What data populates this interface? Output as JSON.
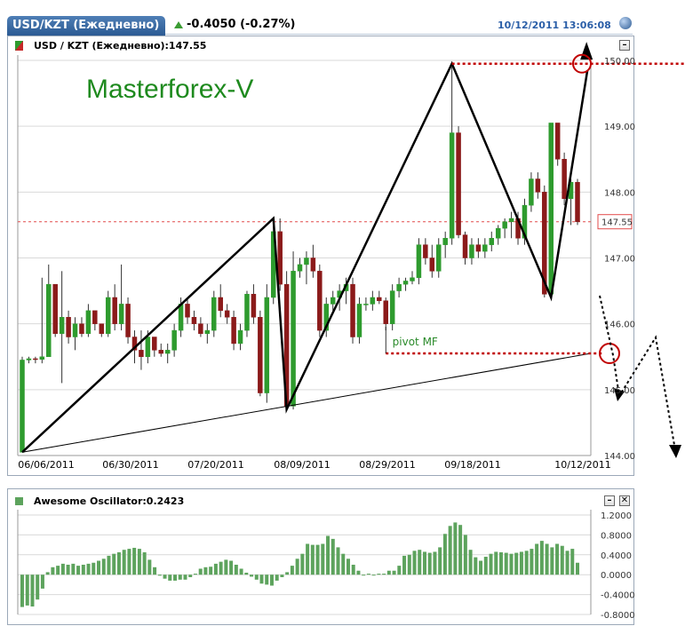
{
  "header": {
    "tab_label": "USD/KZT (Ежедневно)",
    "change": "-0.4050 (-0.27%)",
    "datetime": "10/12/2011 13:06:08"
  },
  "main_panel": {
    "symbol_label": "USD / KZT (Ежедневно):147.55",
    "watermark": "Masterforex-V",
    "pivot_label": "pivot MF",
    "minimize_label": "–"
  },
  "oscillator_panel": {
    "title": "Awesome Oscillator:0.2423",
    "minimize_label": "–",
    "close_label": "✕"
  },
  "colors": {
    "bull": "#2e9b2e",
    "bear": "#8b1a1a",
    "ao": "#5da35d",
    "accent": "#2b5fa8",
    "pivot_line": "#c00000"
  },
  "chart_data": [
    {
      "type": "candlestick",
      "title": "USD / KZT (Ежедневно)",
      "last_price": 147.55,
      "y_ticks": [
        "150.00",
        "149.00",
        "148.00",
        "147.00",
        "146.00",
        "145.00",
        "144.00"
      ],
      "ylim": [
        144.0,
        150.0
      ],
      "x_ticks": [
        "06/06/2011",
        "06/30/2011",
        "07/20/2011",
        "08/09/2011",
        "08/29/2011",
        "09/18/2011",
        "10/12/2011"
      ],
      "grid": true,
      "candles": [
        {
          "o": 144.05,
          "h": 145.5,
          "l": 144.05,
          "c": 145.45
        },
        {
          "o": 145.45,
          "h": 145.5,
          "l": 145.4,
          "c": 145.47
        },
        {
          "o": 145.47,
          "h": 145.5,
          "l": 145.4,
          "c": 145.46
        },
        {
          "o": 145.46,
          "h": 146.7,
          "l": 145.4,
          "c": 145.5
        },
        {
          "o": 145.5,
          "h": 146.9,
          "l": 145.5,
          "c": 146.6
        },
        {
          "o": 146.6,
          "h": 146.6,
          "l": 145.8,
          "c": 145.85
        },
        {
          "o": 145.85,
          "h": 146.8,
          "l": 145.1,
          "c": 146.1
        },
        {
          "o": 146.1,
          "h": 146.2,
          "l": 145.7,
          "c": 145.8
        },
        {
          "o": 145.8,
          "h": 146.1,
          "l": 145.6,
          "c": 146.0
        },
        {
          "o": 146.0,
          "h": 146.1,
          "l": 145.8,
          "c": 145.85
        },
        {
          "o": 145.85,
          "h": 146.3,
          "l": 145.8,
          "c": 146.2
        },
        {
          "o": 146.2,
          "h": 146.2,
          "l": 145.9,
          "c": 146.0
        },
        {
          "o": 146.0,
          "h": 146.0,
          "l": 145.8,
          "c": 145.85
        },
        {
          "o": 145.85,
          "h": 146.5,
          "l": 145.8,
          "c": 146.4
        },
        {
          "o": 146.4,
          "h": 146.6,
          "l": 145.9,
          "c": 146.0
        },
        {
          "o": 146.0,
          "h": 146.9,
          "l": 145.9,
          "c": 146.3
        },
        {
          "o": 146.3,
          "h": 146.4,
          "l": 145.7,
          "c": 145.8
        },
        {
          "o": 145.8,
          "h": 145.9,
          "l": 145.4,
          "c": 145.6
        },
        {
          "o": 145.6,
          "h": 145.9,
          "l": 145.3,
          "c": 145.5
        },
        {
          "o": 145.5,
          "h": 145.9,
          "l": 145.4,
          "c": 145.8
        },
        {
          "o": 145.8,
          "h": 145.8,
          "l": 145.5,
          "c": 145.6
        },
        {
          "o": 145.6,
          "h": 145.7,
          "l": 145.5,
          "c": 145.55
        },
        {
          "o": 145.55,
          "h": 145.7,
          "l": 145.4,
          "c": 145.6
        },
        {
          "o": 145.6,
          "h": 146.0,
          "l": 145.5,
          "c": 145.9
        },
        {
          "o": 145.9,
          "h": 146.4,
          "l": 145.8,
          "c": 146.3
        },
        {
          "o": 146.3,
          "h": 146.4,
          "l": 146.0,
          "c": 146.1
        },
        {
          "o": 146.1,
          "h": 146.2,
          "l": 145.9,
          "c": 146.0
        },
        {
          "o": 146.0,
          "h": 146.1,
          "l": 145.8,
          "c": 145.85
        },
        {
          "o": 145.85,
          "h": 146.0,
          "l": 145.7,
          "c": 145.9
        },
        {
          "o": 145.9,
          "h": 146.5,
          "l": 145.8,
          "c": 146.4
        },
        {
          "o": 146.4,
          "h": 146.6,
          "l": 146.1,
          "c": 146.2
        },
        {
          "o": 146.2,
          "h": 146.3,
          "l": 146.0,
          "c": 146.1
        },
        {
          "o": 146.1,
          "h": 146.2,
          "l": 145.6,
          "c": 145.7
        },
        {
          "o": 145.7,
          "h": 146.0,
          "l": 145.6,
          "c": 145.9
        },
        {
          "o": 145.9,
          "h": 146.5,
          "l": 145.8,
          "c": 146.45
        },
        {
          "o": 146.45,
          "h": 146.6,
          "l": 146.0,
          "c": 146.1
        },
        {
          "o": 146.1,
          "h": 146.2,
          "l": 144.9,
          "c": 144.95
        },
        {
          "o": 144.95,
          "h": 146.6,
          "l": 144.8,
          "c": 146.4
        },
        {
          "o": 146.4,
          "h": 147.55,
          "l": 146.3,
          "c": 147.4
        },
        {
          "o": 147.4,
          "h": 147.6,
          "l": 146.5,
          "c": 146.6
        },
        {
          "o": 146.6,
          "h": 146.8,
          "l": 144.7,
          "c": 144.75
        },
        {
          "o": 144.75,
          "h": 147.1,
          "l": 144.7,
          "c": 146.8
        },
        {
          "o": 146.8,
          "h": 147.0,
          "l": 146.7,
          "c": 146.9
        },
        {
          "o": 146.9,
          "h": 147.1,
          "l": 146.6,
          "c": 147.0
        },
        {
          "o": 147.0,
          "h": 147.2,
          "l": 146.7,
          "c": 146.8
        },
        {
          "o": 146.8,
          "h": 146.9,
          "l": 145.8,
          "c": 145.9
        },
        {
          "o": 145.9,
          "h": 146.4,
          "l": 145.8,
          "c": 146.3
        },
        {
          "o": 146.3,
          "h": 146.5,
          "l": 146.2,
          "c": 146.4
        },
        {
          "o": 146.4,
          "h": 146.6,
          "l": 146.2,
          "c": 146.5
        },
        {
          "o": 146.5,
          "h": 146.7,
          "l": 146.3,
          "c": 146.6
        },
        {
          "o": 146.6,
          "h": 146.7,
          "l": 145.7,
          "c": 145.8
        },
        {
          "o": 145.8,
          "h": 146.4,
          "l": 145.7,
          "c": 146.3
        },
        {
          "o": 146.3,
          "h": 146.4,
          "l": 146.2,
          "c": 146.3
        },
        {
          "o": 146.3,
          "h": 146.5,
          "l": 146.2,
          "c": 146.4
        },
        {
          "o": 146.4,
          "h": 146.5,
          "l": 146.3,
          "c": 146.35
        },
        {
          "o": 146.35,
          "h": 146.4,
          "l": 145.9,
          "c": 146.0
        },
        {
          "o": 146.0,
          "h": 146.6,
          "l": 145.9,
          "c": 146.5
        },
        {
          "o": 146.5,
          "h": 146.7,
          "l": 146.4,
          "c": 146.6
        },
        {
          "o": 146.6,
          "h": 146.7,
          "l": 146.5,
          "c": 146.65
        },
        {
          "o": 146.65,
          "h": 146.8,
          "l": 146.6,
          "c": 146.7
        },
        {
          "o": 146.7,
          "h": 147.3,
          "l": 146.6,
          "c": 147.2
        },
        {
          "o": 147.2,
          "h": 147.3,
          "l": 146.9,
          "c": 147.0
        },
        {
          "o": 147.0,
          "h": 147.2,
          "l": 146.7,
          "c": 146.8
        },
        {
          "o": 146.8,
          "h": 147.3,
          "l": 146.7,
          "c": 147.2
        },
        {
          "o": 147.2,
          "h": 147.4,
          "l": 147.0,
          "c": 147.3
        },
        {
          "o": 147.3,
          "h": 149.9,
          "l": 147.2,
          "c": 148.9
        },
        {
          "o": 148.9,
          "h": 149.0,
          "l": 147.3,
          "c": 147.35
        },
        {
          "o": 147.35,
          "h": 147.4,
          "l": 146.9,
          "c": 147.0
        },
        {
          "o": 147.0,
          "h": 147.3,
          "l": 146.9,
          "c": 147.2
        },
        {
          "o": 147.2,
          "h": 147.3,
          "l": 147.0,
          "c": 147.1
        },
        {
          "o": 147.1,
          "h": 147.3,
          "l": 147.0,
          "c": 147.2
        },
        {
          "o": 147.2,
          "h": 147.4,
          "l": 147.1,
          "c": 147.3
        },
        {
          "o": 147.3,
          "h": 147.5,
          "l": 147.2,
          "c": 147.45
        },
        {
          "o": 147.45,
          "h": 147.6,
          "l": 147.3,
          "c": 147.55
        },
        {
          "o": 147.55,
          "h": 147.7,
          "l": 147.3,
          "c": 147.6
        },
        {
          "o": 147.6,
          "h": 147.7,
          "l": 147.2,
          "c": 147.3
        },
        {
          "o": 147.3,
          "h": 147.9,
          "l": 147.2,
          "c": 147.8
        },
        {
          "o": 147.8,
          "h": 148.3,
          "l": 147.7,
          "c": 148.2
        },
        {
          "o": 148.2,
          "h": 148.3,
          "l": 147.9,
          "c": 148.0
        },
        {
          "o": 148.0,
          "h": 148.1,
          "l": 146.4,
          "c": 146.45
        },
        {
          "o": 146.45,
          "h": 149.05,
          "l": 146.4,
          "c": 149.05
        },
        {
          "o": 149.05,
          "h": 149.05,
          "l": 148.4,
          "c": 148.5
        },
        {
          "o": 148.5,
          "h": 148.6,
          "l": 147.8,
          "c": 147.9
        },
        {
          "o": 147.9,
          "h": 148.2,
          "l": 147.5,
          "c": 148.15
        },
        {
          "o": 148.15,
          "h": 148.2,
          "l": 147.5,
          "c": 147.55
        }
      ],
      "annotations": {
        "zigzag": [
          {
            "bar": 0,
            "price": 144.05
          },
          {
            "bar": 38,
            "price": 147.6
          },
          {
            "bar": 40,
            "price": 144.7
          },
          {
            "bar": 65,
            "price": 149.95
          },
          {
            "bar": 80,
            "price": 146.4
          },
          {
            "bar": 85.5,
            "price": 149.85
          }
        ],
        "support_line": [
          {
            "bar": 0,
            "price": 144.05
          },
          {
            "bar": 86,
            "price": 145.55
          }
        ],
        "pivot_level": 145.55,
        "resistance_level": 149.95
      }
    },
    {
      "type": "bar",
      "title": "Awesome Oscillator",
      "current_value": 0.2423,
      "y_ticks": [
        "1.2000",
        "0.8000",
        "0.4000",
        "0.0000",
        "-0.4000",
        "-0.8000"
      ],
      "ylim": [
        -0.8,
        1.2
      ],
      "values": [
        -0.65,
        -0.62,
        -0.64,
        -0.5,
        -0.28,
        0.05,
        0.15,
        0.18,
        0.22,
        0.2,
        0.22,
        0.18,
        0.2,
        0.22,
        0.24,
        0.28,
        0.32,
        0.38,
        0.42,
        0.45,
        0.5,
        0.52,
        0.54,
        0.52,
        0.45,
        0.3,
        0.15,
        -0.02,
        -0.08,
        -0.12,
        -0.12,
        -0.1,
        -0.1,
        -0.05,
        0.02,
        0.12,
        0.15,
        0.16,
        0.22,
        0.26,
        0.3,
        0.28,
        0.2,
        0.12,
        0.04,
        -0.04,
        -0.1,
        -0.18,
        -0.2,
        -0.22,
        -0.12,
        -0.05,
        0.05,
        0.18,
        0.32,
        0.42,
        0.62,
        0.6,
        0.6,
        0.62,
        0.78,
        0.72,
        0.55,
        0.42,
        0.32,
        0.2,
        0.08,
        0.0,
        0.02,
        0.0,
        0.02,
        0.02,
        0.08,
        0.08,
        0.18,
        0.38,
        0.4,
        0.48,
        0.5,
        0.46,
        0.44,
        0.46,
        0.55,
        0.82,
        0.98,
        1.05,
        1.0,
        0.8,
        0.5,
        0.35,
        0.28,
        0.36,
        0.42,
        0.46,
        0.45,
        0.44,
        0.42,
        0.44,
        0.46,
        0.48,
        0.52,
        0.62,
        0.68,
        0.62,
        0.55,
        0.62,
        0.58,
        0.48,
        0.52,
        0.24
      ]
    }
  ]
}
